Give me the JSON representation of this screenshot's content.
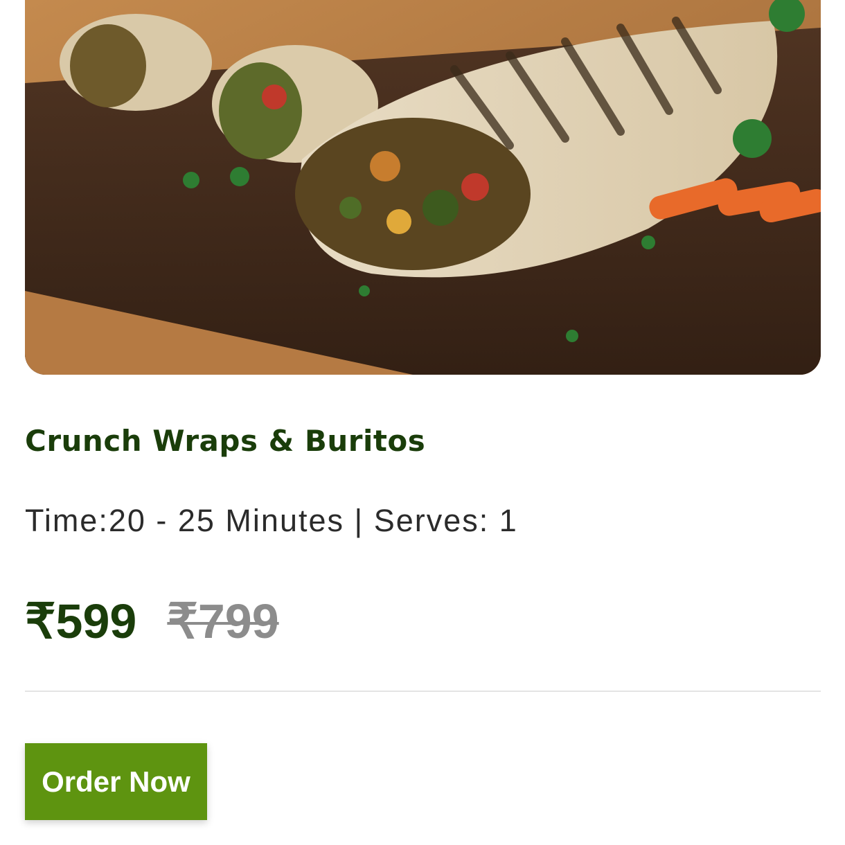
{
  "product": {
    "image_alt": "Grilled vegetable wraps on a wooden board",
    "title": "Crunch Wraps & Buritos",
    "meta": "Time:20 - 25 Minutes | Serves: 1",
    "price_current": "₹599",
    "price_original": "₹799"
  },
  "actions": {
    "order_label": "Order Now"
  },
  "colors": {
    "title": "#1a3d0a",
    "button": "#5e9410",
    "strike_price": "#8c8c8c"
  }
}
